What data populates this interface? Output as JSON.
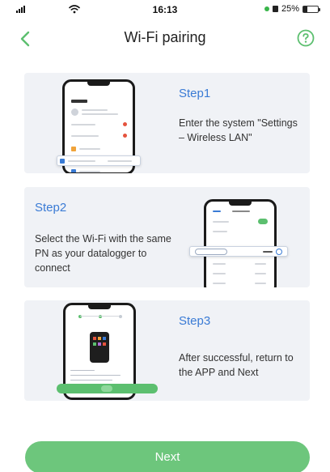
{
  "status_bar": {
    "time": "16:13",
    "battery_text": "25%",
    "battery_level": 0.25,
    "icons": [
      "signal-icon",
      "wifi-icon",
      "location-dot-icon",
      "lock-icon",
      "battery-icon"
    ]
  },
  "nav": {
    "title": "Wi-Fi pairing",
    "back_icon": "chevron-left-icon",
    "help_icon": "help-circle-icon"
  },
  "steps": [
    {
      "title": "Step1",
      "text": "Enter the system \"Settings – Wireless LAN\"",
      "illustration": "phone-settings-screenshot"
    },
    {
      "title": "Step2",
      "text": "Select the Wi-Fi with the same PN as your datalogger to connect",
      "illustration": "phone-wifi-list-screenshot"
    },
    {
      "title": "Step3",
      "text": "After successful, return to the APP and Next",
      "illustration": "phone-app-screenshot"
    }
  ],
  "next_button": {
    "label": "Next"
  },
  "colors": {
    "accent_green": "#39b54a",
    "button_green": "#6dc67c",
    "step_blue": "#3a7bd5",
    "card_background": "#f0f2f6"
  }
}
